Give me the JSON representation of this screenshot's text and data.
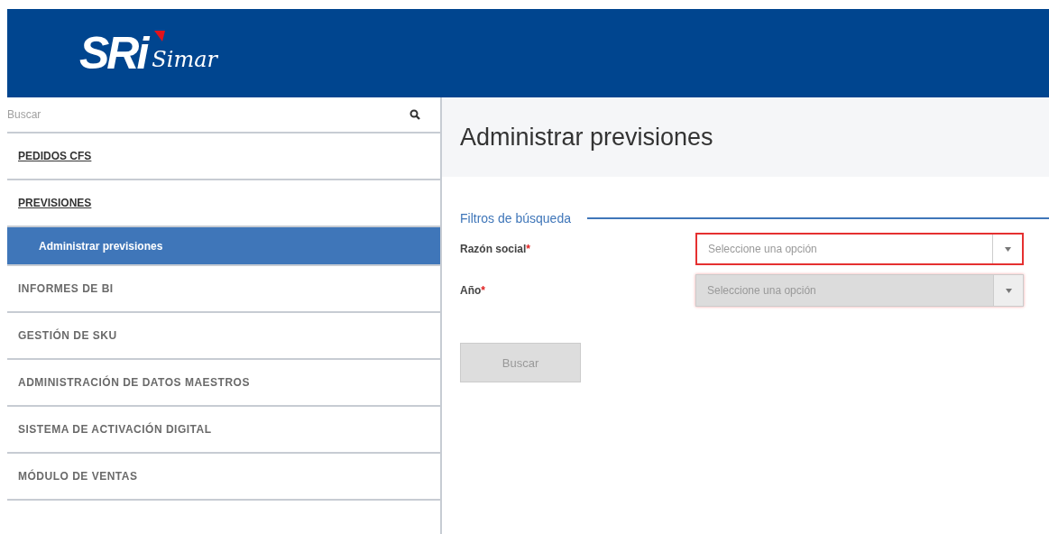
{
  "header": {
    "logo_mark": "SRi",
    "logo_word": "Simar"
  },
  "sidebar": {
    "search": {
      "placeholder": "Buscar"
    },
    "items": [
      {
        "label": "PEDIDOS CFS",
        "kind": "link",
        "selected": false
      },
      {
        "label": "PREVISIONES",
        "kind": "link",
        "selected": false
      },
      {
        "label": "Administrar previsiones",
        "kind": "subitem",
        "selected": true
      },
      {
        "label": "INFORMES DE BI",
        "kind": "group",
        "selected": false
      },
      {
        "label": "GESTIÓN DE SKU",
        "kind": "group",
        "selected": false
      },
      {
        "label": "ADMINISTRACIÓN DE DATOS MAESTROS",
        "kind": "group",
        "selected": false
      },
      {
        "label": "SISTEMA DE ACTIVACIÓN DIGITAL",
        "kind": "group",
        "selected": false
      },
      {
        "label": "MÓDULO DE VENTAS",
        "kind": "group",
        "selected": false
      }
    ]
  },
  "page_title": "Administrar previsiones",
  "filters": {
    "legend": "Filtros de búsqueda",
    "fields": [
      {
        "label": "Razón social",
        "required_mark": "*",
        "placeholder": "Seleccione una opción",
        "invalid": true,
        "disabled": false
      },
      {
        "label": "Año",
        "required_mark": "*",
        "placeholder": "Seleccione una opción",
        "invalid": false,
        "disabled": true
      }
    ],
    "button": {
      "label": "Buscar",
      "disabled": true
    }
  }
}
